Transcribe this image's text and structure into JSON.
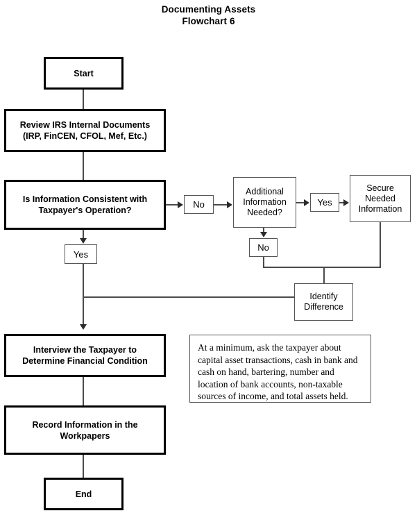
{
  "title": {
    "line1": "Documenting Assets",
    "line2": "Flowchart 6"
  },
  "nodes": {
    "start": {
      "label": "Start"
    },
    "review": {
      "label": "Review IRS Internal Documents\n(IRP, FinCEN, CFOL, Mef, Etc.)"
    },
    "consistent_decision": {
      "label": "Is Information Consistent with\nTaxpayer's Operation?"
    },
    "consistent_no": {
      "label": "No"
    },
    "consistent_yes": {
      "label": "Yes"
    },
    "additional_info_decision": {
      "label": "Additional\nInformation\nNeeded?"
    },
    "additional_no": {
      "label": "No"
    },
    "additional_yes": {
      "label": "Yes"
    },
    "secure_info": {
      "label": "Secure\nNeeded\nInformation"
    },
    "identify_difference": {
      "label": "Identify\nDifference"
    },
    "interview": {
      "label": "Interview the Taxpayer to\nDetermine Financial Condition"
    },
    "record": {
      "label": "Record Information in the\nWorkpapers"
    },
    "end": {
      "label": "End"
    }
  },
  "note": {
    "text": "At a minimum, ask the taxpayer about capital asset transactions, cash in bank and cash on hand, bartering, number and location of bank accounts, non-taxable sources of income, and total assets held."
  },
  "colors": {
    "background": "#ffffff",
    "text": "#000000",
    "heavy_border": "#000000",
    "light_border": "#555555",
    "connector": "#4a4a4a"
  }
}
